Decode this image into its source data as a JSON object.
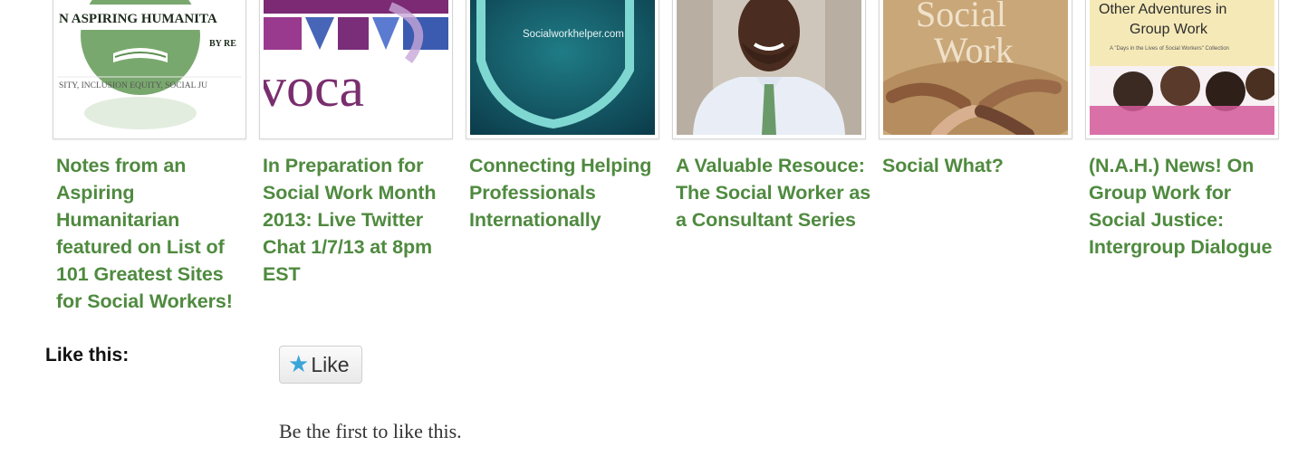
{
  "related_posts": [
    {
      "title": "Notes from an Aspiring Humanitarian featured on List of 101 Greatest Sites for Social Workers!",
      "thumb": {
        "line1": "N ASPIRING HUMANITA",
        "line2": "BY RE",
        "line3": "SITY, INCLUSION EQUITY, SOCIAL JU"
      }
    },
    {
      "title": "In Preparation for Social Work Month 2013: Live Twitter Chat 1/7/13 at 8pm EST",
      "thumb": {
        "line1": "voca"
      }
    },
    {
      "title": "Connecting Helping Professionals Internationally",
      "thumb": {
        "line1": "Socialworkhelper.com"
      }
    },
    {
      "title": "A Valuable Resouce: The Social Worker as a Consultant Series",
      "thumb": {}
    },
    {
      "title": "Social What?",
      "thumb": {
        "line1": "Social",
        "line2": "Work"
      }
    },
    {
      "title": "(N.A.H.) News! On Group Work for Social Justice: Intergroup Dialogue",
      "thumb": {
        "line1": "Other Adventures in",
        "line2": "Group Work",
        "line3": "A \"Days in the Lives of Social Workers\" Collection"
      }
    }
  ],
  "like": {
    "heading": "Like this:",
    "button_label": "Like",
    "message": "Be the first to like this."
  },
  "colors": {
    "link": "#4f8a3f",
    "star": "#3ba5d8"
  }
}
